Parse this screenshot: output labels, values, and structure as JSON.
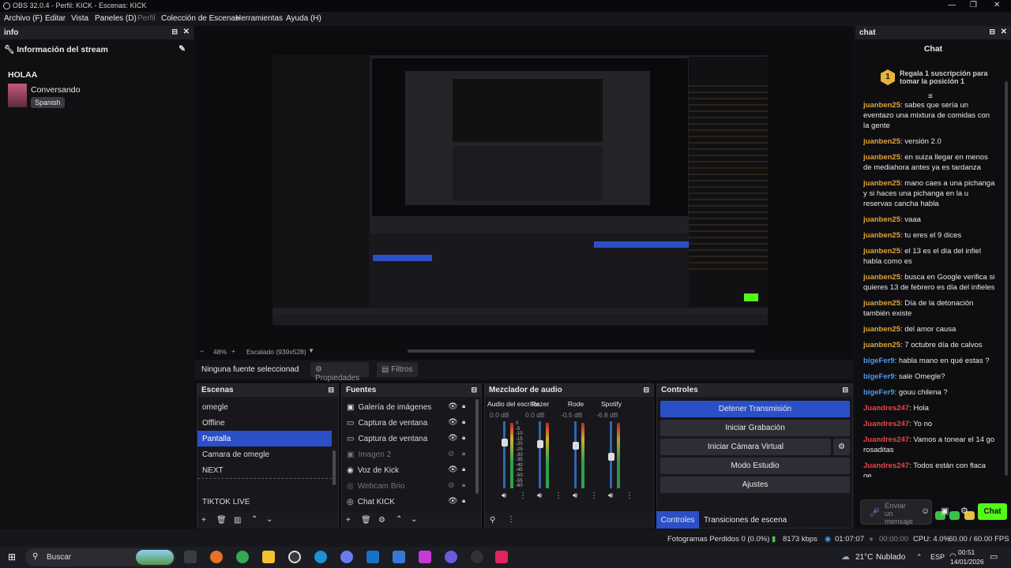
{
  "window": {
    "title": "OBS 32.0.4 - Perfil: KICK - Escenas: KICK"
  },
  "menu": [
    "Archivo (F)",
    "Editar",
    "Vista",
    "Paneles (D)",
    "Perfil",
    "Colección de Escenas",
    "Herramientas",
    "Ayuda (H)"
  ],
  "info": {
    "panel_title": "info",
    "section_title": "Información del stream",
    "stream_title": "HOLAA",
    "category": "Conversando",
    "language": "Spanish"
  },
  "preview_bar": {
    "zoom": "48%",
    "scaling": "Escalado (939x528)"
  },
  "source_toolbar": {
    "no_source": "Ninguna fuente seleccionad",
    "properties": "Propiedades",
    "filters": "Filtros"
  },
  "scenes": {
    "title": "Escenas",
    "items": [
      "omegle",
      "Offline",
      "Pantalla",
      "Camara de omegle",
      "NEXT",
      "TIKTOK LIVE"
    ],
    "selected": "Pantalla"
  },
  "sources": {
    "title": "Fuentes",
    "items": [
      {
        "icon": "image-icon",
        "label": "Galería de imágenes",
        "visible": true
      },
      {
        "icon": "window-icon",
        "label": "Captura de ventana",
        "visible": true
      },
      {
        "icon": "window-icon",
        "label": "Captura de ventana",
        "visible": true
      },
      {
        "icon": "image-icon",
        "label": "Imagen 2",
        "visible": false
      },
      {
        "icon": "audio-icon",
        "label": "Voz de Kick",
        "visible": true
      },
      {
        "icon": "browser-icon",
        "label": "Webcam Brio",
        "visible": false
      },
      {
        "icon": "browser-icon",
        "label": "Chat KICK",
        "visible": true
      }
    ]
  },
  "mixer": {
    "title": "Mezclador de audio",
    "channels": [
      {
        "name": "Audio del escritorio",
        "db": "0.0 dB",
        "level": 0.72
      },
      {
        "name": "Razer",
        "db": "0.0 dB",
        "level": 0.7
      },
      {
        "name": "Rode",
        "db": "-0.5 dB",
        "level": 0.68
      },
      {
        "name": "Spotify",
        "db": "-6.8 dB",
        "level": 0.5
      }
    ],
    "scale": [
      "0",
      "-5",
      "-10",
      "-15",
      "-20",
      "-25",
      "-30",
      "-35",
      "-40",
      "-45",
      "-50",
      "-55",
      "-60"
    ]
  },
  "controls": {
    "title": "Controles",
    "stop_stream": "Detener Transmisión",
    "start_recording": "Iniciar Grabación",
    "start_virtual_cam": "Iniciar Cámara Virtual",
    "studio_mode": "Modo Estudio",
    "settings": "Ajustes",
    "tab_controls": "Controles",
    "tab_transitions": "Transiciones de escena"
  },
  "chat": {
    "panel_title": "chat",
    "header": "Chat",
    "sub_banner": "Regala 1 suscripción para tomar la posición 1",
    "sub_rank": "1",
    "input_placeholder": "Enviar un mensaje",
    "send_label": "Chat",
    "messages": [
      {
        "user": "juanben25",
        "text": "sabes que sería un eventazo una mixtura de comidas con la gente",
        "color": "#e0a43a"
      },
      {
        "user": "juanben25",
        "text": "versión 2.0",
        "color": "#e0a43a"
      },
      {
        "user": "juanben25",
        "text": "en suiza llegar en menos de mediahora antes ya es tardanza",
        "color": "#e0a43a"
      },
      {
        "user": "juanben25",
        "text": "mano caes a una pichanga y si haces una pichanga en la u reservas cancha habla",
        "color": "#e0a43a"
      },
      {
        "user": "juanben25",
        "text": "vaaa",
        "color": "#e0a43a"
      },
      {
        "user": "juanben25",
        "text": "tu eres el 9 dices",
        "color": "#e0a43a"
      },
      {
        "user": "juanben25",
        "text": "el 13 es el día del infiel habla como es",
        "color": "#e0a43a"
      },
      {
        "user": "juanben25",
        "text": "busca en Google verifica si quieres 13 de febrero es día del infieles",
        "color": "#e0a43a"
      },
      {
        "user": "juanben25",
        "text": "Día de la detonación también existe",
        "color": "#e0a43a"
      },
      {
        "user": "juanben25",
        "text": "del amor causa",
        "color": "#e0a43a"
      },
      {
        "user": "juanben25",
        "text": "7 octubre día de calvos",
        "color": "#e0a43a"
      },
      {
        "user": "bigeFer9",
        "text": "habla mano en qué estas ?",
        "color": "#4d9be8"
      },
      {
        "user": "bigeFer9",
        "text": "sale Omegle?",
        "color": "#4d9be8"
      },
      {
        "user": "bigeFer9",
        "text": "gouu chilena ?",
        "color": "#4d9be8"
      },
      {
        "user": "Juandres247",
        "text": "Hola",
        "color": "#e84545"
      },
      {
        "user": "Juandres247",
        "text": "Yo no",
        "color": "#e84545"
      },
      {
        "user": "Juandres247",
        "text": "Vamos a tonear el 14 go rosaditas",
        "color": "#e84545"
      },
      {
        "user": "Juandres247",
        "text": "Todos están con flaca oe",
        "color": "#e84545"
      }
    ]
  },
  "status": {
    "dropped": "Fotogramas Perdidos 0 (0.0%)",
    "bitrate": "8173 kbps",
    "stream_time": "01:07:07",
    "rec_time": "00:00:00",
    "cpu": "CPU: 4.0%",
    "fps": "60.00 / 60.00 FPS"
  },
  "taskbar": {
    "search": "Buscar",
    "weather_temp": "21°C",
    "weather_desc": "Nublado",
    "lang": "ESP",
    "time": "00:51",
    "date": "14/01/2026"
  },
  "colors": {
    "accent": "#2b4fc7",
    "kick_green": "#53fc18",
    "panel": "#17171c"
  }
}
